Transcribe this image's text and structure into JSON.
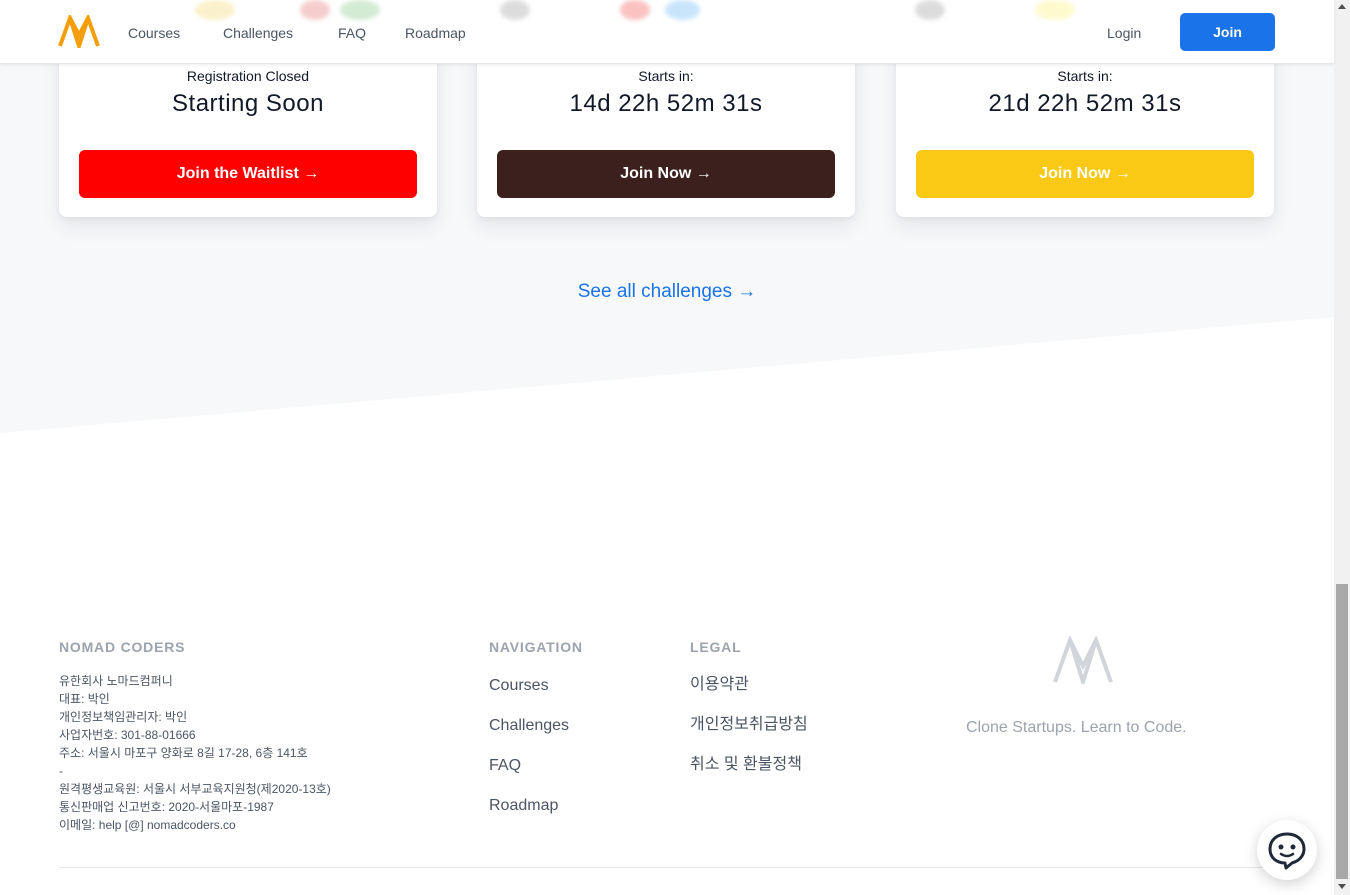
{
  "header": {
    "nav": [
      "Courses",
      "Challenges",
      "FAQ",
      "Roadmap"
    ],
    "login_label": "Login",
    "join_label": "Join",
    "logo_icon": "nomad-logo-icon"
  },
  "cards": [
    {
      "label": "Registration Closed",
      "big": "Starting Soon",
      "button": "Join the Waitlist →",
      "button_color": "#ff0000"
    },
    {
      "label": "Starts in:",
      "big": "14d 22h 52m 31s",
      "button": "Join Now →",
      "button_color": "#3b201d"
    },
    {
      "label": "Starts in:",
      "big": "21d 22h 52m 31s",
      "button": "Join Now →",
      "button_color": "#f9c916"
    }
  ],
  "see_all": "See all challenges →",
  "footer": {
    "company_heading": "NOMAD CODERS",
    "company_lines": [
      "유한회사 노마드컴퍼니",
      "대표: 박인",
      "개인정보책임관리자: 박인",
      "사업자번호: 301-88-01666",
      "주소: 서울시 마포구 양화로 8길 17-28, 6층 141호",
      "-",
      "원격평생교육원: 서울시 서부교육지원청(제2020-13호)",
      "통신판매업 신고번호: 2020-서울마포-1987",
      "이메일: help [@] nomadcoders.co"
    ],
    "navigation_heading": "NAVIGATION",
    "navigation_links": [
      "Courses",
      "Challenges",
      "FAQ",
      "Roadmap"
    ],
    "legal_heading": "LEGAL",
    "legal_links": [
      "이용약관",
      "개인정보취급방침",
      "취소 및 환불정책"
    ],
    "tagline": "Clone Startups. Learn to Code."
  },
  "colors": {
    "accent": "#1a73e8",
    "logo_orange": "#f59e0b",
    "band_bg": "#f7f8fa"
  }
}
